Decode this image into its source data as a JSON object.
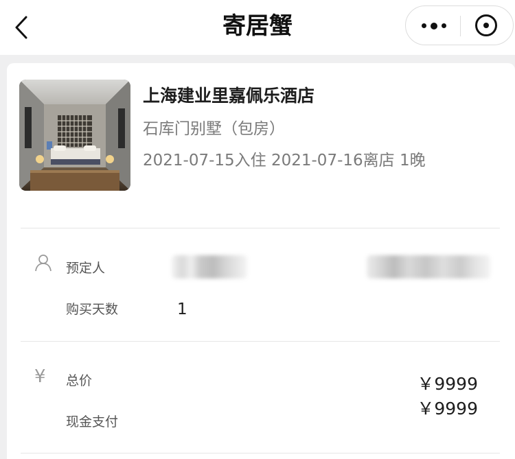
{
  "navbar": {
    "title": "寄居蟹",
    "back_icon": "chevron-left-icon",
    "more_icon": "more-dots-icon",
    "close_icon": "target-circle-icon"
  },
  "booking": {
    "hotel_name": "上海建业里嘉佩乐酒店",
    "room_type": "石库门别墅（包房）",
    "stay_dates": "2021-07-15入住 2021-07-16离店 1晚"
  },
  "guest": {
    "icon": "person-icon",
    "booker_label": "预定人",
    "days_label": "购买天数",
    "days_value": "1"
  },
  "payment": {
    "icon": "yen-icon",
    "yen_symbol": "¥",
    "total_label": "总价",
    "cash_label": "现金支付",
    "total_value": "￥9999",
    "cash_value": "￥9999"
  },
  "colors": {
    "background": "#efeff0",
    "card": "#ffffff",
    "primary_text": "#1d1d1d",
    "secondary_text": "#7a7a7a"
  }
}
